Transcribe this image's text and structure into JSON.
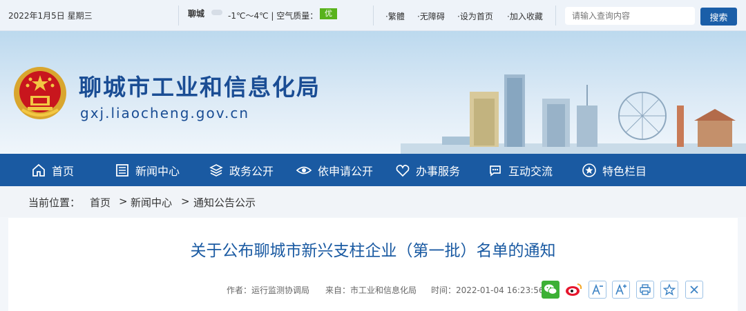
{
  "topbar": {
    "date": "2022年1月5日 星期三",
    "city": "聊城",
    "temperature": "-1℃～4℃",
    "separator": "|",
    "air_quality_label": "空气质量：",
    "air_quality_value": "优",
    "links": [
      "·繁體",
      "·无障碍",
      "·设为首页",
      "·加入收藏"
    ],
    "search_placeholder": "请输入查询内容",
    "search_button": "搜索"
  },
  "header": {
    "title": "聊城市工业和信息化局",
    "domain": "gxj.liaocheng.gov.cn"
  },
  "nav": {
    "items": [
      "首页",
      "新闻中心",
      "政务公开",
      "依申请公开",
      "办事服务",
      "互动交流",
      "特色栏目"
    ]
  },
  "breadcrumb": {
    "label": "当前位置：",
    "items": [
      "首页",
      "新闻中心",
      "通知公告公示"
    ],
    "separator": ">"
  },
  "article": {
    "title": "关于公布聊城市新兴支柱企业（第一批）名单的通知",
    "author_label": "作者：",
    "author": "运行监测协调局",
    "source_label": "来自：",
    "source": "市工业和信息化局",
    "time_label": "时间：",
    "time": "2022-01-04 16:23:56",
    "share_icons": [
      "wechat-icon",
      "weibo-icon"
    ],
    "tools": [
      "font-decrease-icon",
      "font-increase-icon",
      "print-icon",
      "favorite-icon",
      "close-icon"
    ]
  },
  "colors": {
    "brand": "#1a5aa2",
    "title": "#1a4d94",
    "air_quality_good": "#58b21b",
    "wechat": "#3cb035"
  }
}
